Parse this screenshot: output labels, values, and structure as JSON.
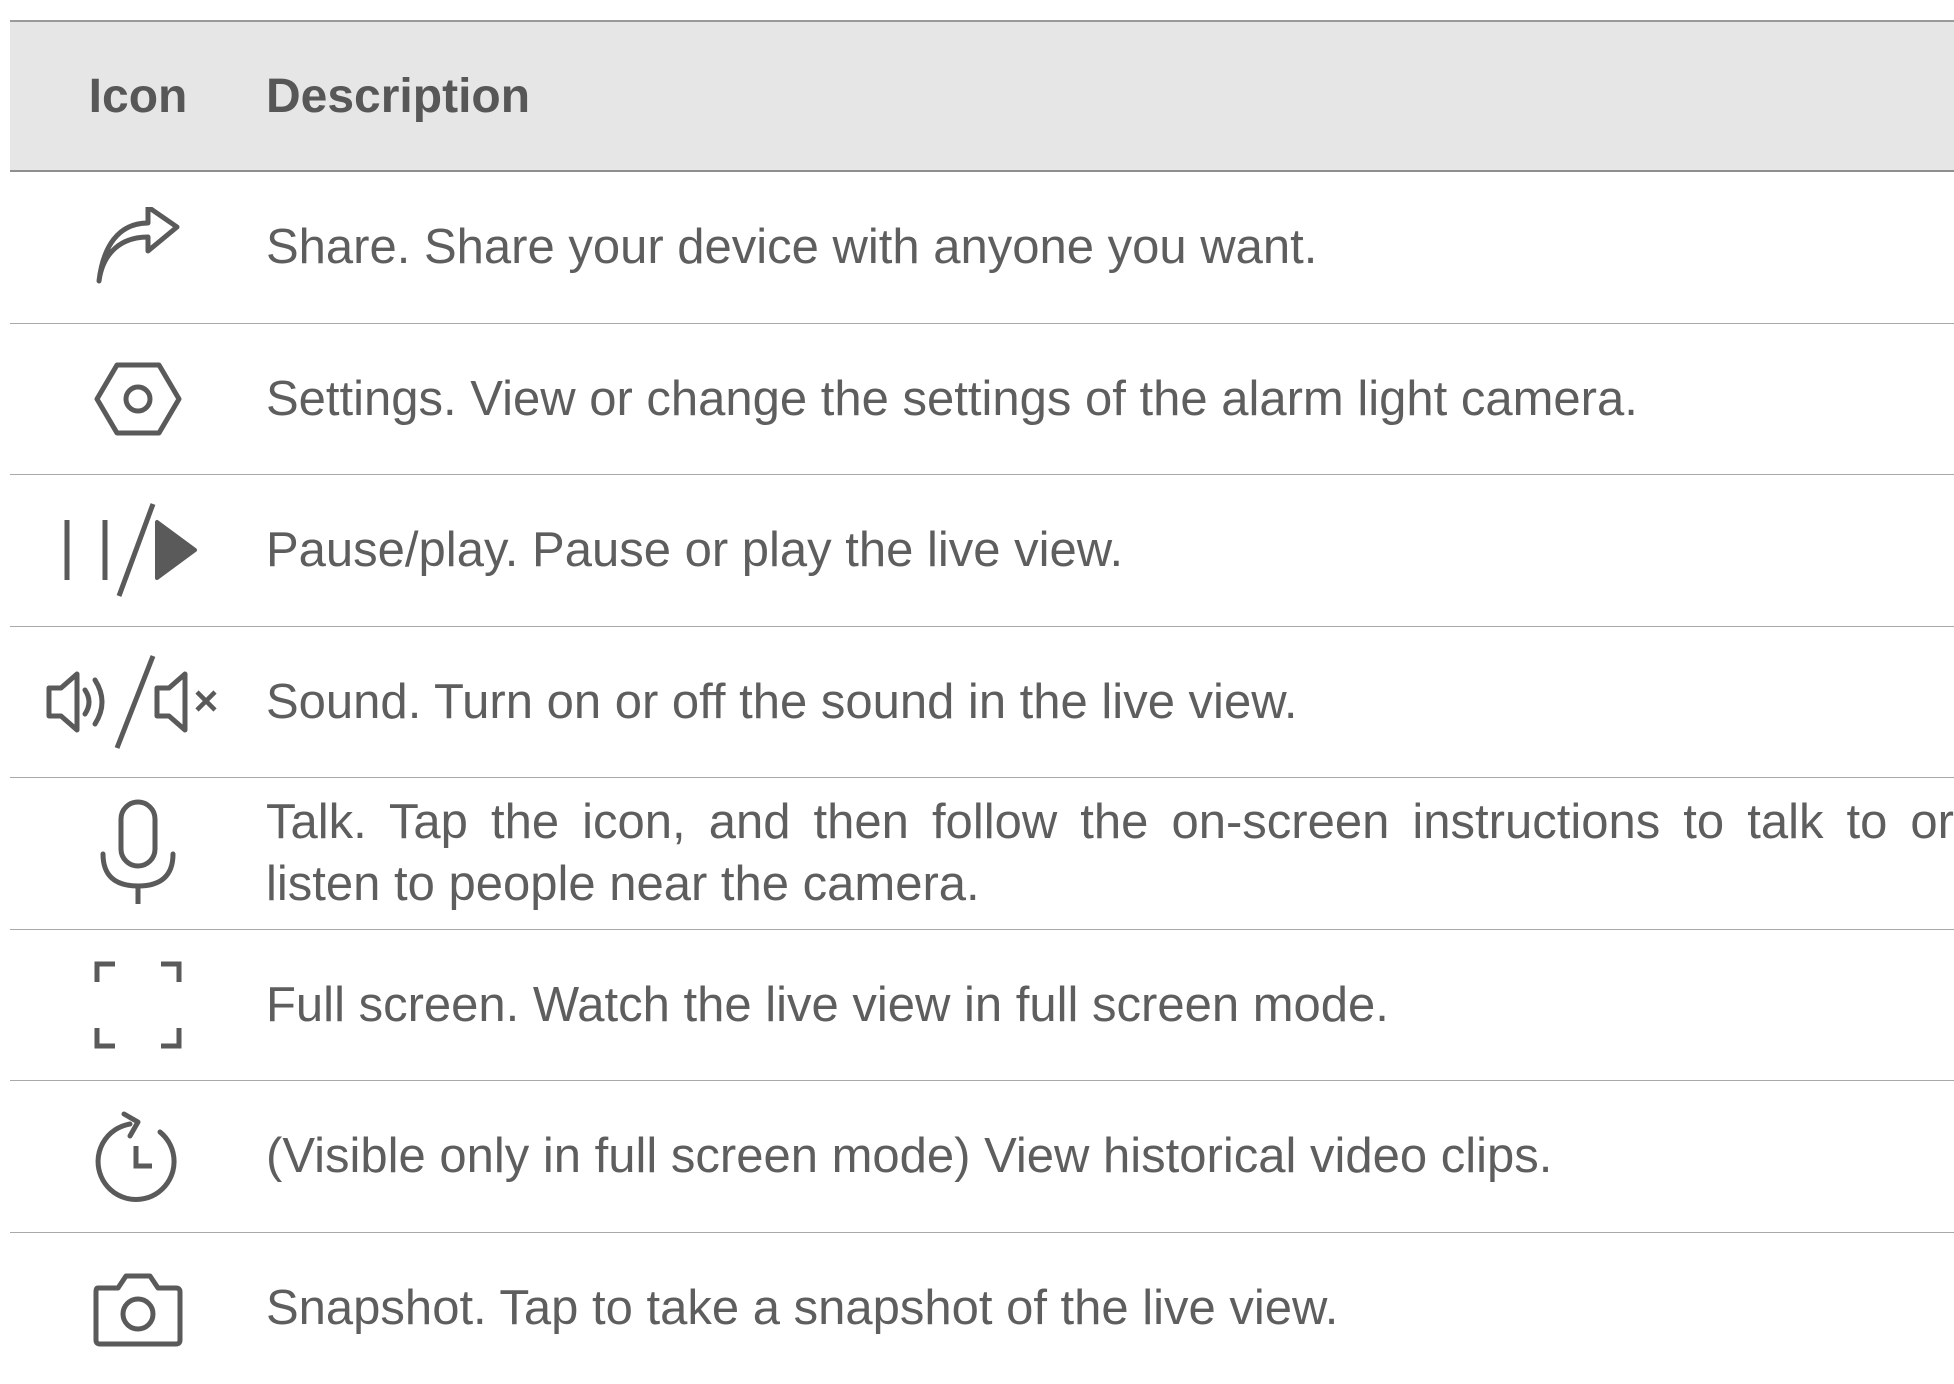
{
  "table": {
    "headers": {
      "icon": "Icon",
      "description": "Description"
    },
    "rows": [
      {
        "icon": "share-icon",
        "description": "Share. Share your device with anyone you want."
      },
      {
        "icon": "settings-hexagon-icon",
        "description": "Settings. View or change the settings of the alarm light camera."
      },
      {
        "icon": "pause-play-icon",
        "description": "Pause/play. Pause or play the live view."
      },
      {
        "icon": "sound-on-off-icon",
        "description": "Sound. Turn on or off the sound in the live view."
      },
      {
        "icon": "microphone-icon",
        "description": "Talk. Tap the icon, and then follow the on-screen instructions to talk to or listen to people near the camera."
      },
      {
        "icon": "full-screen-icon",
        "description": "Full screen. Watch the live view in full screen mode."
      },
      {
        "icon": "history-clock-icon",
        "description": "(Visible only in full screen mode) View historical video clips."
      },
      {
        "icon": "camera-icon",
        "description": "Snapshot. Tap to take a snapshot of the live view."
      }
    ]
  },
  "colors": {
    "header_bg": "#e6e6e6",
    "text": "#5e5e5e",
    "rule": "#a9a9a9"
  }
}
